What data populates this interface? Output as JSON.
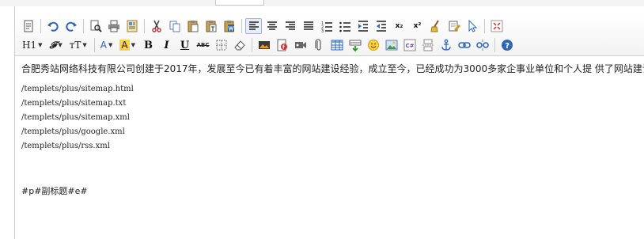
{
  "window": {
    "title": ""
  },
  "content": {
    "intro": "合肥秀站网络科技有限公司创建于2017年，发展至今已有着丰富的网站建设经验，成立至今，已经成功为3000多家企事业单位和个人提 供了网站建设",
    "paths": [
      "/templets/plus/sitemap.html",
      "/templets/plus/sitemap.txt",
      "/templets/plus/sitemap.xml",
      "/templets/plus/google.xml",
      "/templets/plus/rss.xml"
    ],
    "marker": "#p#副标题#e#"
  },
  "toolbar": {
    "heading_label": "H1",
    "font_family_label": "𝓕",
    "font_size_label": "тT",
    "font_color_label": "A",
    "highlight_label": "A",
    "bold_label": "B",
    "italic_label": "I",
    "underline_label": "U",
    "strike_label": "ABC",
    "subscript_label": "x₂",
    "superscript_label": "x²"
  },
  "colors": {
    "accent": "#2f66b8",
    "highlight": "#ffd24a",
    "toolbar_border": "#d3d3d3"
  }
}
